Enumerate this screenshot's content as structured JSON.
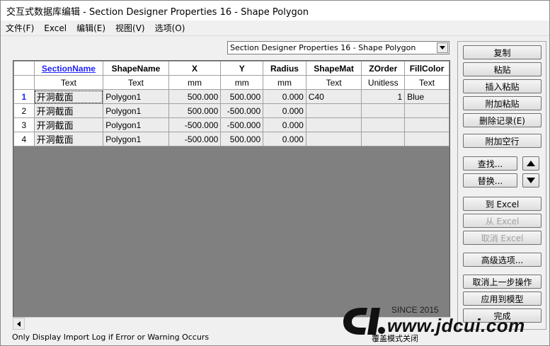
{
  "window": {
    "title": "交互式数据库编辑 - Section Designer Properties 16 - Shape Polygon"
  },
  "menu": [
    "文件(F)",
    "Excel",
    "编辑(E)",
    "视图(V)",
    "选项(O)"
  ],
  "table_selector": {
    "value": "Section Designer Properties 16 - Shape Polygon"
  },
  "grid": {
    "headers": [
      "SectionName",
      "ShapeName",
      "X",
      "Y",
      "Radius",
      "ShapeMat",
      "ZOrder",
      "FillColor"
    ],
    "units": [
      "Text",
      "Text",
      "mm",
      "mm",
      "mm",
      "Text",
      "Unitless",
      "Text"
    ],
    "rows": [
      {
        "num": "1",
        "cells": [
          "开洞截面",
          "Polygon1",
          "500.000",
          "500.000",
          "0.000",
          "C40",
          "1",
          "Blue"
        ]
      },
      {
        "num": "2",
        "cells": [
          "开洞截面",
          "Polygon1",
          "500.000",
          "-500.000",
          "0.000",
          "",
          "",
          ""
        ]
      },
      {
        "num": "3",
        "cells": [
          "开洞截面",
          "Polygon1",
          "-500.000",
          "-500.000",
          "0.000",
          "",
          "",
          ""
        ]
      },
      {
        "num": "4",
        "cells": [
          "开洞截面",
          "Polygon1",
          "-500.000",
          "500.000",
          "0.000",
          "",
          "",
          ""
        ]
      }
    ]
  },
  "buttons": {
    "copy": "复制",
    "paste": "粘贴",
    "insert_paste": "插入粘贴",
    "append_paste": "附加粘贴",
    "delete_records": "删除记录(E)",
    "append_empty_rows": "附加空行",
    "find": "查找...",
    "replace": "替换...",
    "to_excel": "到 Excel",
    "from_excel": "从 Excel",
    "cancel_excel": "取消 Excel",
    "advanced": "高级选项...",
    "undo": "取消上一步操作",
    "apply": "应用到模型",
    "done": "完成"
  },
  "status": {
    "left": "Only Display Import Log if Error or Warning Occurs",
    "right": "覆盖模式关闭"
  },
  "watermark": {
    "since": "SINCE 2015",
    "url": "www.jdcui.com"
  }
}
